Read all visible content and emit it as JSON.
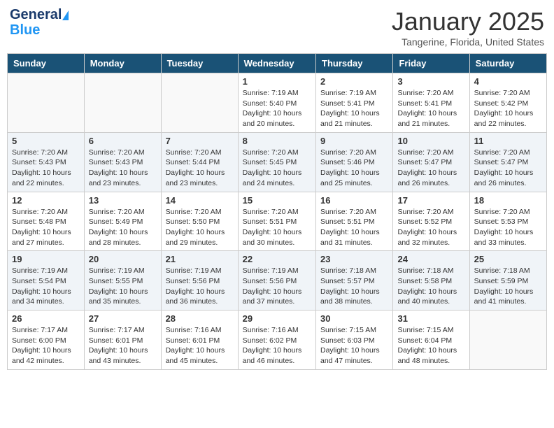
{
  "header": {
    "logo_general": "General",
    "logo_blue": "Blue",
    "month_title": "January 2025",
    "location": "Tangerine, Florida, United States"
  },
  "days_of_week": [
    "Sunday",
    "Monday",
    "Tuesday",
    "Wednesday",
    "Thursday",
    "Friday",
    "Saturday"
  ],
  "weeks": [
    [
      {
        "day": "",
        "info": ""
      },
      {
        "day": "",
        "info": ""
      },
      {
        "day": "",
        "info": ""
      },
      {
        "day": "1",
        "info": "Sunrise: 7:19 AM\nSunset: 5:40 PM\nDaylight: 10 hours\nand 20 minutes."
      },
      {
        "day": "2",
        "info": "Sunrise: 7:19 AM\nSunset: 5:41 PM\nDaylight: 10 hours\nand 21 minutes."
      },
      {
        "day": "3",
        "info": "Sunrise: 7:20 AM\nSunset: 5:41 PM\nDaylight: 10 hours\nand 21 minutes."
      },
      {
        "day": "4",
        "info": "Sunrise: 7:20 AM\nSunset: 5:42 PM\nDaylight: 10 hours\nand 22 minutes."
      }
    ],
    [
      {
        "day": "5",
        "info": "Sunrise: 7:20 AM\nSunset: 5:43 PM\nDaylight: 10 hours\nand 22 minutes."
      },
      {
        "day": "6",
        "info": "Sunrise: 7:20 AM\nSunset: 5:43 PM\nDaylight: 10 hours\nand 23 minutes."
      },
      {
        "day": "7",
        "info": "Sunrise: 7:20 AM\nSunset: 5:44 PM\nDaylight: 10 hours\nand 23 minutes."
      },
      {
        "day": "8",
        "info": "Sunrise: 7:20 AM\nSunset: 5:45 PM\nDaylight: 10 hours\nand 24 minutes."
      },
      {
        "day": "9",
        "info": "Sunrise: 7:20 AM\nSunset: 5:46 PM\nDaylight: 10 hours\nand 25 minutes."
      },
      {
        "day": "10",
        "info": "Sunrise: 7:20 AM\nSunset: 5:47 PM\nDaylight: 10 hours\nand 26 minutes."
      },
      {
        "day": "11",
        "info": "Sunrise: 7:20 AM\nSunset: 5:47 PM\nDaylight: 10 hours\nand 26 minutes."
      }
    ],
    [
      {
        "day": "12",
        "info": "Sunrise: 7:20 AM\nSunset: 5:48 PM\nDaylight: 10 hours\nand 27 minutes."
      },
      {
        "day": "13",
        "info": "Sunrise: 7:20 AM\nSunset: 5:49 PM\nDaylight: 10 hours\nand 28 minutes."
      },
      {
        "day": "14",
        "info": "Sunrise: 7:20 AM\nSunset: 5:50 PM\nDaylight: 10 hours\nand 29 minutes."
      },
      {
        "day": "15",
        "info": "Sunrise: 7:20 AM\nSunset: 5:51 PM\nDaylight: 10 hours\nand 30 minutes."
      },
      {
        "day": "16",
        "info": "Sunrise: 7:20 AM\nSunset: 5:51 PM\nDaylight: 10 hours\nand 31 minutes."
      },
      {
        "day": "17",
        "info": "Sunrise: 7:20 AM\nSunset: 5:52 PM\nDaylight: 10 hours\nand 32 minutes."
      },
      {
        "day": "18",
        "info": "Sunrise: 7:20 AM\nSunset: 5:53 PM\nDaylight: 10 hours\nand 33 minutes."
      }
    ],
    [
      {
        "day": "19",
        "info": "Sunrise: 7:19 AM\nSunset: 5:54 PM\nDaylight: 10 hours\nand 34 minutes."
      },
      {
        "day": "20",
        "info": "Sunrise: 7:19 AM\nSunset: 5:55 PM\nDaylight: 10 hours\nand 35 minutes."
      },
      {
        "day": "21",
        "info": "Sunrise: 7:19 AM\nSunset: 5:56 PM\nDaylight: 10 hours\nand 36 minutes."
      },
      {
        "day": "22",
        "info": "Sunrise: 7:19 AM\nSunset: 5:56 PM\nDaylight: 10 hours\nand 37 minutes."
      },
      {
        "day": "23",
        "info": "Sunrise: 7:18 AM\nSunset: 5:57 PM\nDaylight: 10 hours\nand 38 minutes."
      },
      {
        "day": "24",
        "info": "Sunrise: 7:18 AM\nSunset: 5:58 PM\nDaylight: 10 hours\nand 40 minutes."
      },
      {
        "day": "25",
        "info": "Sunrise: 7:18 AM\nSunset: 5:59 PM\nDaylight: 10 hours\nand 41 minutes."
      }
    ],
    [
      {
        "day": "26",
        "info": "Sunrise: 7:17 AM\nSunset: 6:00 PM\nDaylight: 10 hours\nand 42 minutes."
      },
      {
        "day": "27",
        "info": "Sunrise: 7:17 AM\nSunset: 6:01 PM\nDaylight: 10 hours\nand 43 minutes."
      },
      {
        "day": "28",
        "info": "Sunrise: 7:16 AM\nSunset: 6:01 PM\nDaylight: 10 hours\nand 45 minutes."
      },
      {
        "day": "29",
        "info": "Sunrise: 7:16 AM\nSunset: 6:02 PM\nDaylight: 10 hours\nand 46 minutes."
      },
      {
        "day": "30",
        "info": "Sunrise: 7:15 AM\nSunset: 6:03 PM\nDaylight: 10 hours\nand 47 minutes."
      },
      {
        "day": "31",
        "info": "Sunrise: 7:15 AM\nSunset: 6:04 PM\nDaylight: 10 hours\nand 48 minutes."
      },
      {
        "day": "",
        "info": ""
      }
    ]
  ]
}
